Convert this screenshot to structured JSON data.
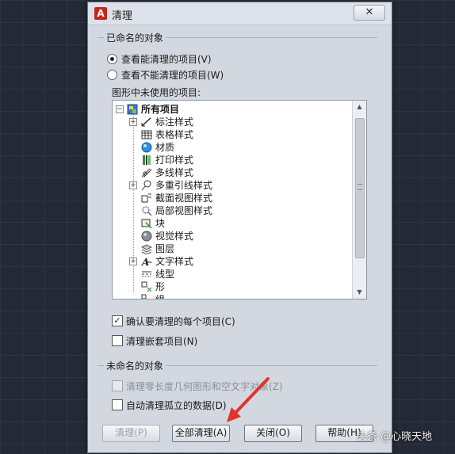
{
  "dialog": {
    "title": "清理",
    "close_label": "✕",
    "app_icon": "A"
  },
  "named_section": {
    "label": "已命名的对象",
    "radio_viewable": "查看能清理的项目(V)",
    "radio_not_viewable": "查看不能清理的项目(W)",
    "radio_selected": "radio_viewable",
    "tree_caption": "图形中未使用的项目:",
    "tree": {
      "root": "所有项目",
      "items": [
        {
          "label": "标注样式",
          "icon": "dimension-style-icon",
          "expandable": true
        },
        {
          "label": "表格样式",
          "icon": "table-style-icon",
          "expandable": false
        },
        {
          "label": "材质",
          "icon": "material-sphere-icon",
          "expandable": false
        },
        {
          "label": "打印样式",
          "icon": "plot-style-icon",
          "expandable": false
        },
        {
          "label": "多线样式",
          "icon": "multiline-style-icon",
          "expandable": false
        },
        {
          "label": "多重引线样式",
          "icon": "multileader-style-icon",
          "expandable": true
        },
        {
          "label": "截面视图样式",
          "icon": "section-view-style-icon",
          "expandable": false
        },
        {
          "label": "局部视图样式",
          "icon": "detail-view-style-icon",
          "expandable": false
        },
        {
          "label": "块",
          "icon": "block-icon",
          "expandable": false
        },
        {
          "label": "视觉样式",
          "icon": "visual-style-icon",
          "expandable": false
        },
        {
          "label": "图层",
          "icon": "layer-icon",
          "expandable": false
        },
        {
          "label": "文字样式",
          "icon": "text-style-icon",
          "expandable": true
        },
        {
          "label": "线型",
          "icon": "linetype-icon",
          "expandable": false
        },
        {
          "label": "形",
          "icon": "shape-icon",
          "expandable": false
        },
        {
          "label": "组",
          "icon": "group-icon",
          "expandable": false
        }
      ]
    },
    "confirm_each": {
      "label": "确认要清理的每个项目(C)",
      "checked": true
    },
    "purge_nested": {
      "label": "清理嵌套项目(N)",
      "checked": false
    }
  },
  "unnamed_section": {
    "label": "未命名的对象",
    "zero_length": {
      "label": "清理零长度几何图形和空文字对象(Z)",
      "checked": false,
      "disabled": true
    },
    "orphan_data": {
      "label": "自动清理孤立的数据(D)",
      "checked": false
    }
  },
  "buttons": {
    "purge": "清理(P)",
    "purge_all": "全部清理(A)",
    "close": "关闭(O)",
    "help": "帮助(H)"
  },
  "watermark": "头条 @心晓天地",
  "colors": {
    "background": "#232a36",
    "dialog": "#d3d8e0",
    "annotation_arrow": "#e0342a"
  }
}
